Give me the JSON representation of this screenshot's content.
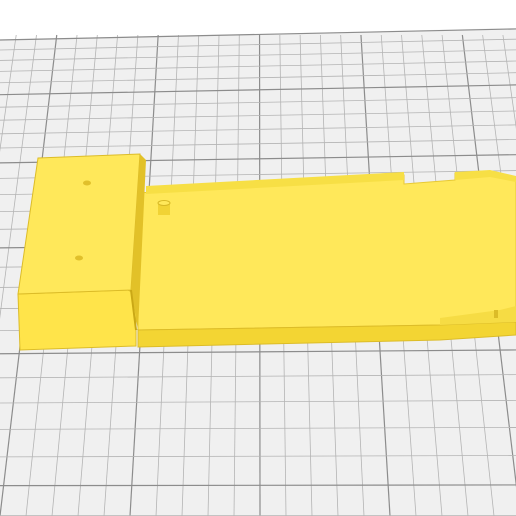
{
  "viewport": {
    "view": "perspective",
    "background_color": "#ffffff",
    "build_plate": {
      "grid_line_color": "#b4b4b4",
      "grid_major_color": "#8c8c8c",
      "plate_color": "#f0f0f0"
    },
    "model": {
      "color_top": "#ffe85a",
      "color_front": "#f2d232",
      "color_side": "#e6c628",
      "edge_color": "#c8a814",
      "shadow_color": "#d6b51e",
      "selected": false
    }
  }
}
